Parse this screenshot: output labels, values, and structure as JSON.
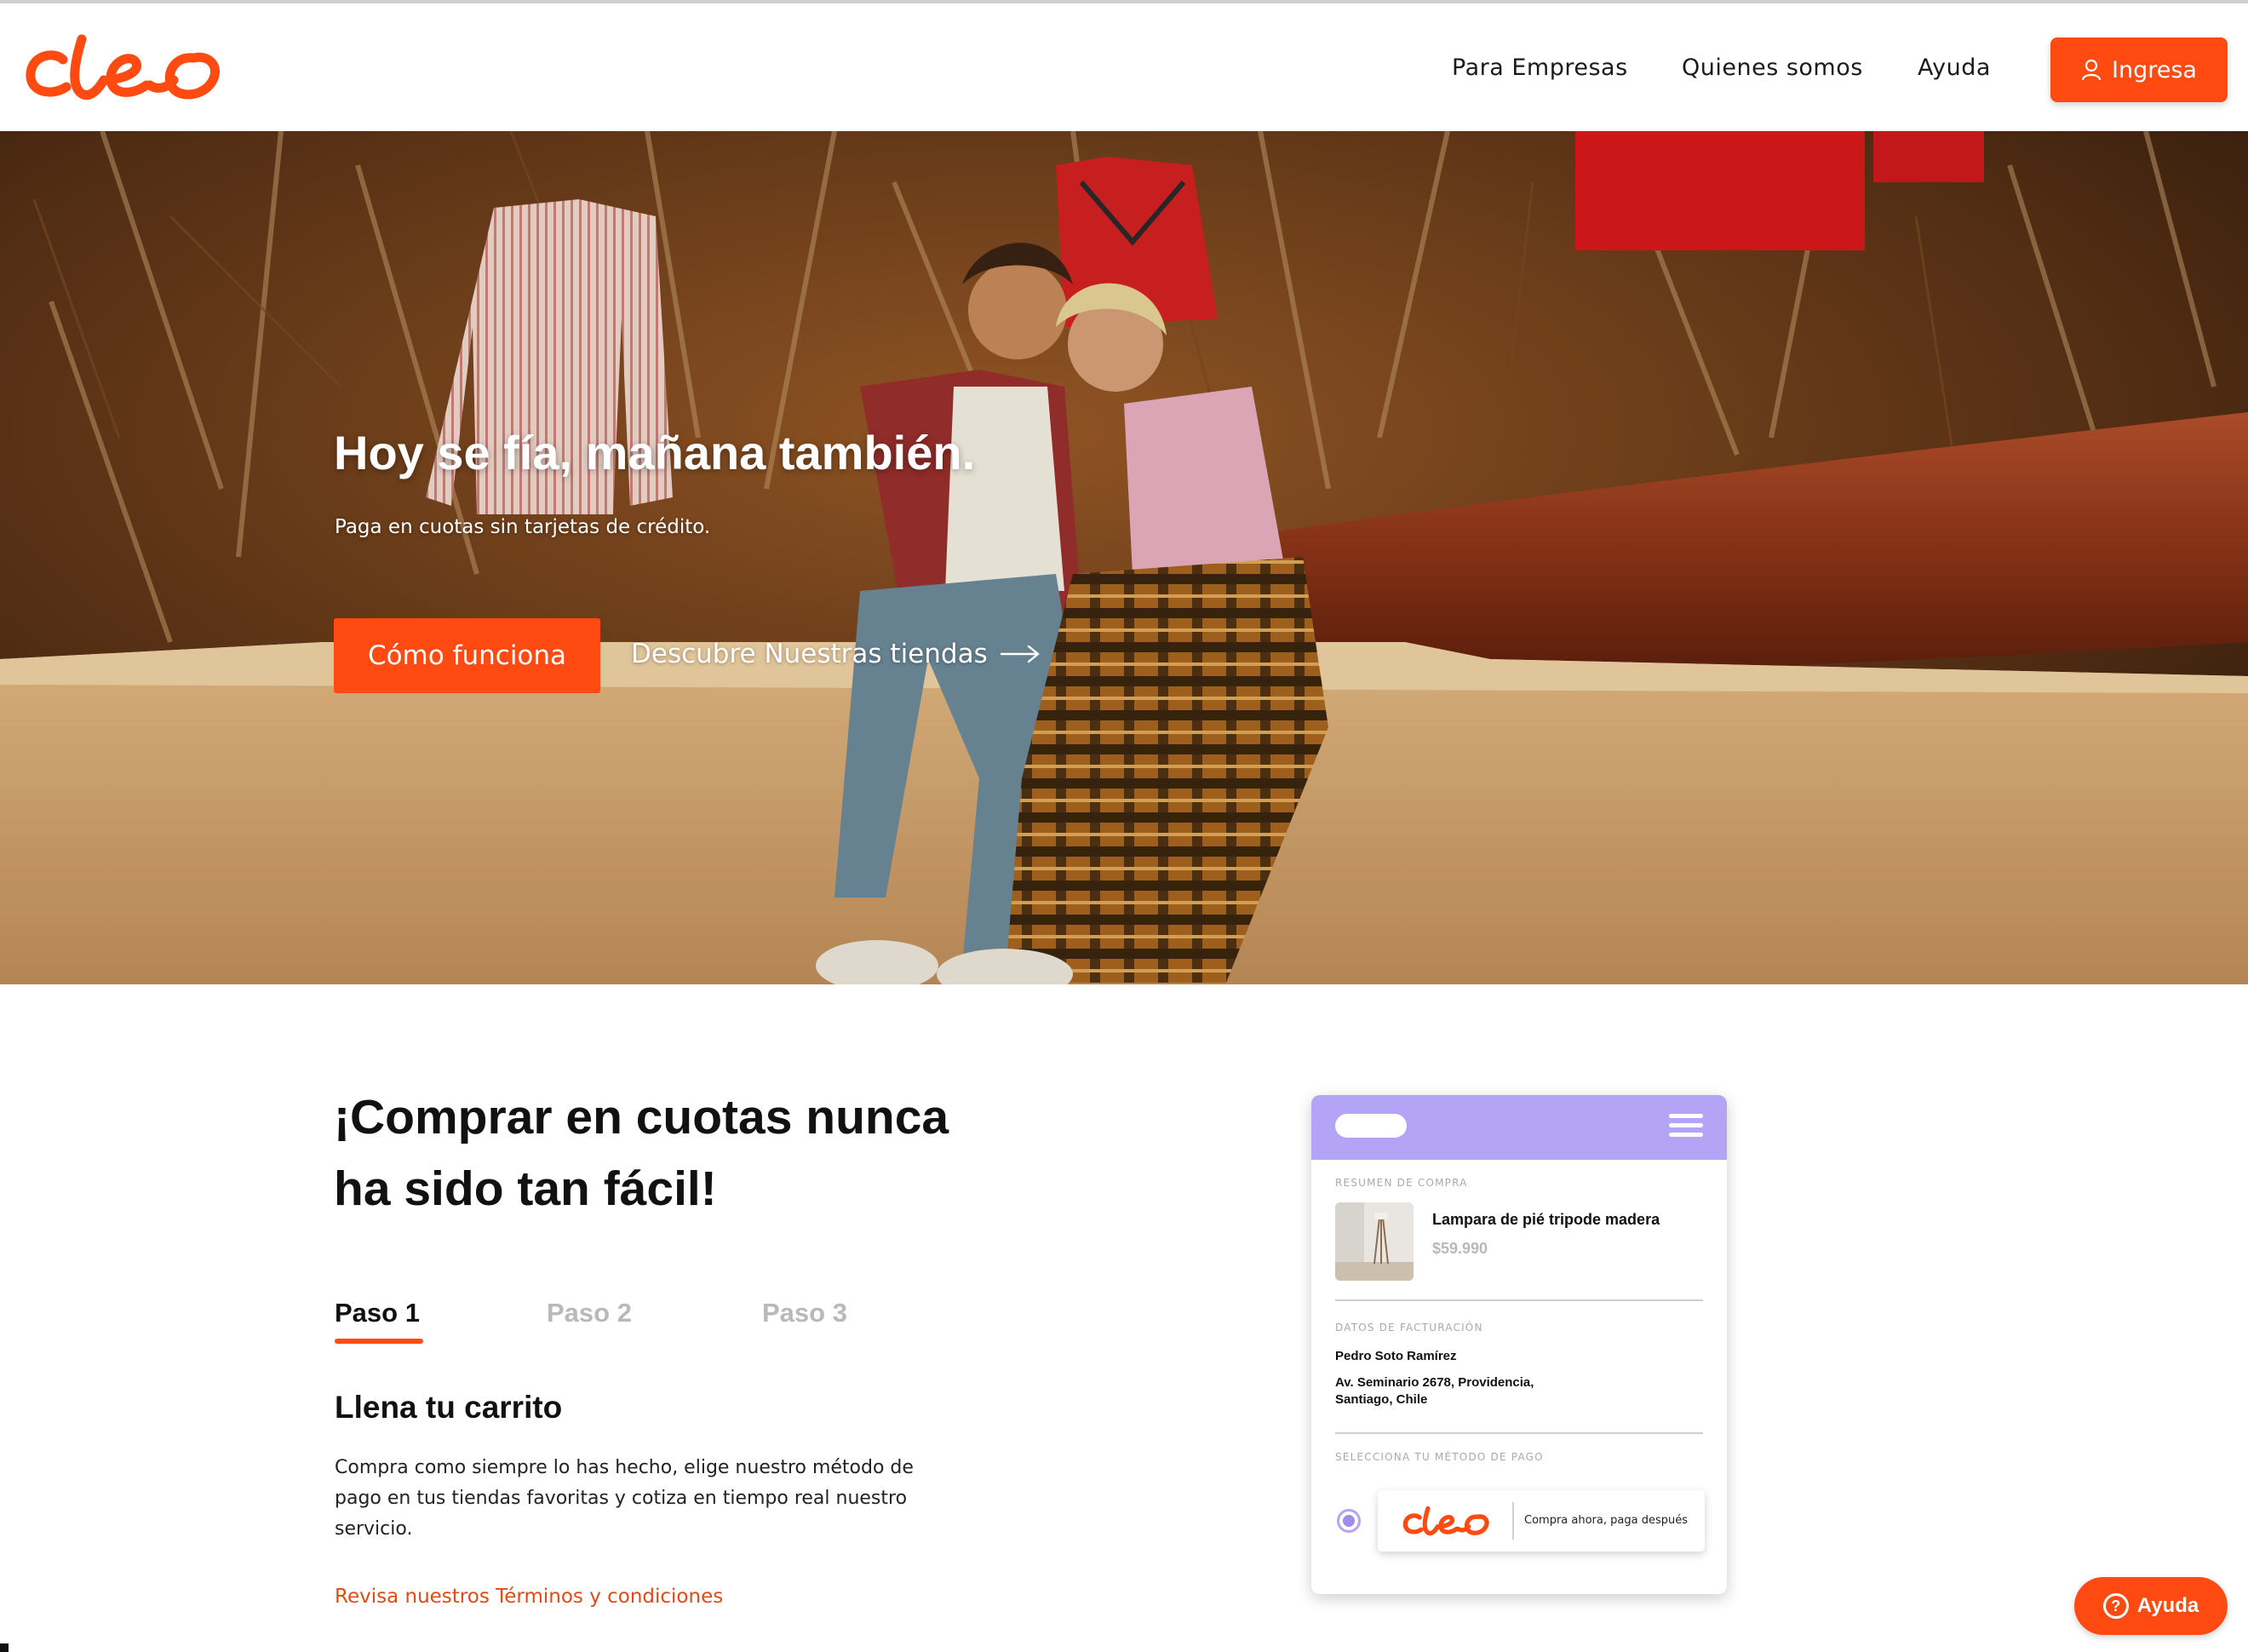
{
  "header": {
    "logo_text": "cleo",
    "nav": [
      "Para Empresas",
      "Quienes somos",
      "Ayuda"
    ],
    "login_label": "Ingresa",
    "login_icon": "user-icon"
  },
  "hero": {
    "title": "Hoy se fía, mañana también.",
    "subtitle": "Paga en cuotas sin tarjetas de crédito.",
    "cta_label": "Cómo funciona",
    "link_label": "Descubre Nuestras tiendas",
    "link_icon": "arrow-right-icon"
  },
  "steps": {
    "title": "¡Comprar en cuotas nunca ha sido tan fácil!",
    "tabs": [
      "Paso 1",
      "Paso 2",
      "Paso 3"
    ],
    "active_tab": 0,
    "step_title": "Llena tu carrito",
    "step_text": "Compra como siempre lo has hecho, elige nuestro método de pago en tus tiendas favoritas y cotiza en tiempo real nuestro servicio.",
    "terms_link": "Revisa nuestros Términos y condiciones"
  },
  "mockup": {
    "summary_label": "RESUMEN DE COMPRA",
    "product_name": "Lampara de pié tripode madera",
    "product_price": "$59.990",
    "billing_label": "DATOS DE FACTURACIÓN",
    "billing_name": "Pedro Soto Ramírez",
    "billing_address": "Av. Seminario 2678, Providencia, Santiago, Chile",
    "payment_label": "SELECCIONA TU MÉTODO DE PAGO",
    "payment_logo": "cleo",
    "payment_tagline": "Compra ahora, paga después"
  },
  "help_button": {
    "label": "Ayuda",
    "icon": "question-icon",
    "icon_glyph": "?"
  },
  "colors": {
    "brand": "#ff4b12",
    "mock_accent": "#b4a4f5"
  }
}
